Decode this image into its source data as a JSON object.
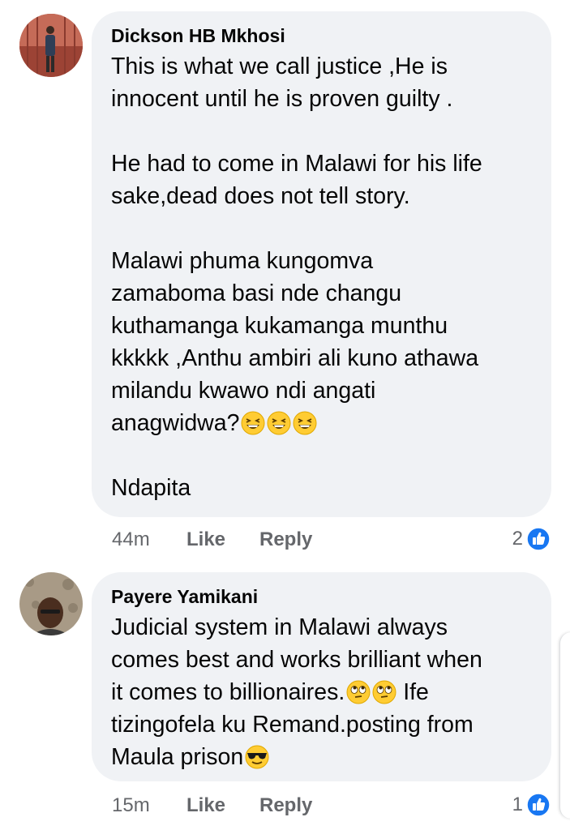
{
  "colors": {
    "bubble_bg": "#f0f2f5",
    "text": "#050505",
    "meta": "#65676b",
    "like_blue": "#1877f2"
  },
  "comments": [
    {
      "author": "Dickson HB Mkhosi",
      "lines": [
        "This is what we call justice ,He is",
        "innocent until he is proven guilty .",
        "",
        "He had to come in Malawi for his life",
        "sake,dead does not tell story.",
        "",
        "Malawi phuma kungomva",
        "zamaboma basi nde changu",
        "kuthamanga kukamanga munthu",
        "kkkkk ,Anthu ambiri ali kuno athawa",
        "milandu kwawo ndi angati",
        "anagwidwa?",
        "",
        "Ndapita"
      ],
      "line_emojis": {
        "11": [
          "grinning-squinting-emoji",
          "grinning-squinting-emoji",
          "grinning-squinting-emoji"
        ]
      },
      "time": "44m",
      "like_label": "Like",
      "reply_label": "Reply",
      "reaction_count": "2",
      "reaction_icon": "thumbs-up-icon"
    },
    {
      "author": "Payere Yamikani",
      "lines": [
        "Judicial system in Malawi always",
        "comes best and works brilliant when",
        "it comes to billionaires.",
        "tizingofela ku Remand.posting from",
        "Maula prison"
      ],
      "line_emojis": {
        "2": [
          "eye-roll-emoji",
          "eye-roll-emoji"
        ],
        "4": [
          "sunglasses-emoji"
        ]
      },
      "line_suffix": {
        "2": " Ife"
      },
      "time": "15m",
      "like_label": "Like",
      "reply_label": "Reply",
      "reaction_count": "1",
      "reaction_icon": "thumbs-up-icon"
    }
  ]
}
